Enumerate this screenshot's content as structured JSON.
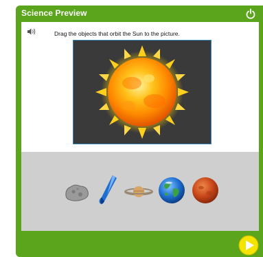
{
  "window": {
    "title": "Science Preview"
  },
  "activity": {
    "instruction": "Drag the objects that orbit the Sun to the picture."
  },
  "drop_target": {
    "image": "sun",
    "border_color": "#2e88b8"
  },
  "tray": {
    "items": [
      {
        "name": "asteroid"
      },
      {
        "name": "comet"
      },
      {
        "name": "saturn"
      },
      {
        "name": "earth"
      },
      {
        "name": "mars"
      }
    ]
  },
  "controls": {
    "power": "power-icon",
    "audio": "speaker-icon",
    "next": "play-icon"
  },
  "colors": {
    "frame": "#5aa51c",
    "tray": "#cfcfcf",
    "accent": "#f5e400"
  }
}
